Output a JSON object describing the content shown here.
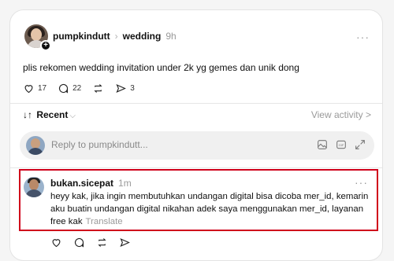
{
  "post": {
    "username": "pumpkindutt",
    "topic": "wedding",
    "time": "9h",
    "more": "···",
    "text": "plis rekomen wedding invitation under 2k yg gemes dan unik dong",
    "likes": "17",
    "comments": "22",
    "shares": "3",
    "icons": [
      "heart-icon",
      "comment-icon",
      "repost-icon",
      "share-icon"
    ]
  },
  "sort": {
    "label": "Recent",
    "view_activity": "View activity >"
  },
  "reply": {
    "placeholder": "Reply to pumpkindutt...",
    "icons": [
      "image-icon",
      "gif-icon",
      "expand-icon"
    ]
  },
  "comment": {
    "username": "bukan.sicepat",
    "time": "1m",
    "more": "···",
    "text": "heyy kak, jika ingin membutuhkan undangan digital bisa dicoba mer_id, kemarin aku buatin undangan digital nikahan adek saya menggunakan mer_id, layanan free kak",
    "translate": "Translate",
    "highlight_color": "#d0021b"
  }
}
